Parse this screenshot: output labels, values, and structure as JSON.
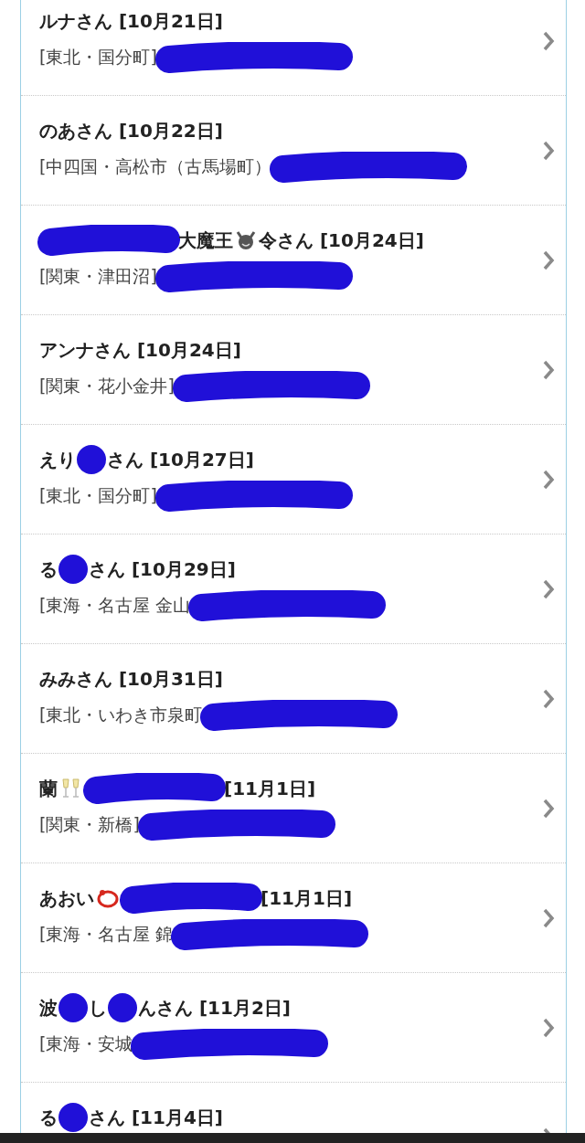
{
  "list": [
    {
      "title": [
        {
          "kind": "text",
          "text": "ルナさん [10月21日]"
        }
      ],
      "subtitle": [
        {
          "kind": "text",
          "text": "[東北・国分町]"
        },
        {
          "kind": "stroke"
        }
      ]
    },
    {
      "title": [
        {
          "kind": "text",
          "text": "のあさん [10月22日]"
        }
      ],
      "subtitle": [
        {
          "kind": "text",
          "text": "[中四国・高松市（古馬場町）"
        },
        {
          "kind": "stroke"
        }
      ]
    },
    {
      "title": [
        {
          "kind": "stroke"
        },
        {
          "kind": "text",
          "text": "大魔王"
        },
        {
          "kind": "devil"
        },
        {
          "kind": "text",
          "text": "令さん [10月24日]"
        }
      ],
      "subtitle": [
        {
          "kind": "text",
          "text": "[関東・津田沼]"
        },
        {
          "kind": "stroke"
        }
      ]
    },
    {
      "title": [
        {
          "kind": "text",
          "text": "アンナさん [10月24日]"
        }
      ],
      "subtitle": [
        {
          "kind": "text",
          "text": "[関東・花小金井]"
        },
        {
          "kind": "stroke"
        }
      ]
    },
    {
      "title": [
        {
          "kind": "text",
          "text": "えり"
        },
        {
          "kind": "dot"
        },
        {
          "kind": "text",
          "text": "さん [10月27日]"
        }
      ],
      "subtitle": [
        {
          "kind": "text",
          "text": "[東北・国分町]"
        },
        {
          "kind": "stroke"
        }
      ]
    },
    {
      "title": [
        {
          "kind": "text",
          "text": "る"
        },
        {
          "kind": "dot"
        },
        {
          "kind": "text",
          "text": "さん [10月29日]"
        }
      ],
      "subtitle": [
        {
          "kind": "text",
          "text": "[東海・名古屋 金山"
        },
        {
          "kind": "stroke"
        }
      ]
    },
    {
      "title": [
        {
          "kind": "text",
          "text": "みみさん [10月31日]"
        }
      ],
      "subtitle": [
        {
          "kind": "text",
          "text": "[東北・いわき市泉町"
        },
        {
          "kind": "stroke"
        }
      ]
    },
    {
      "title": [
        {
          "kind": "text",
          "text": "蘭"
        },
        {
          "kind": "glasses"
        },
        {
          "kind": "stroke"
        },
        {
          "kind": "text",
          "text": "[11月1日]"
        }
      ],
      "subtitle": [
        {
          "kind": "text",
          "text": "[関東・新橋]"
        },
        {
          "kind": "stroke"
        }
      ]
    },
    {
      "title": [
        {
          "kind": "text",
          "text": "あおい"
        },
        {
          "kind": "ring"
        },
        {
          "kind": "stroke"
        },
        {
          "kind": "text",
          "text": "[11月1日]"
        }
      ],
      "subtitle": [
        {
          "kind": "text",
          "text": "[東海・名古屋 錦"
        },
        {
          "kind": "stroke"
        }
      ]
    },
    {
      "title": [
        {
          "kind": "text",
          "text": "波"
        },
        {
          "kind": "dot"
        },
        {
          "kind": "text",
          "text": "し"
        },
        {
          "kind": "dot"
        },
        {
          "kind": "text",
          "text": "んさん [11月2日]"
        }
      ],
      "subtitle": [
        {
          "kind": "text",
          "text": "[東海・安城"
        },
        {
          "kind": "stroke"
        }
      ]
    },
    {
      "title": [
        {
          "kind": "text",
          "text": "る"
        },
        {
          "kind": "dot"
        },
        {
          "kind": "text",
          "text": "さん [11月4日]"
        }
      ]
    }
  ]
}
